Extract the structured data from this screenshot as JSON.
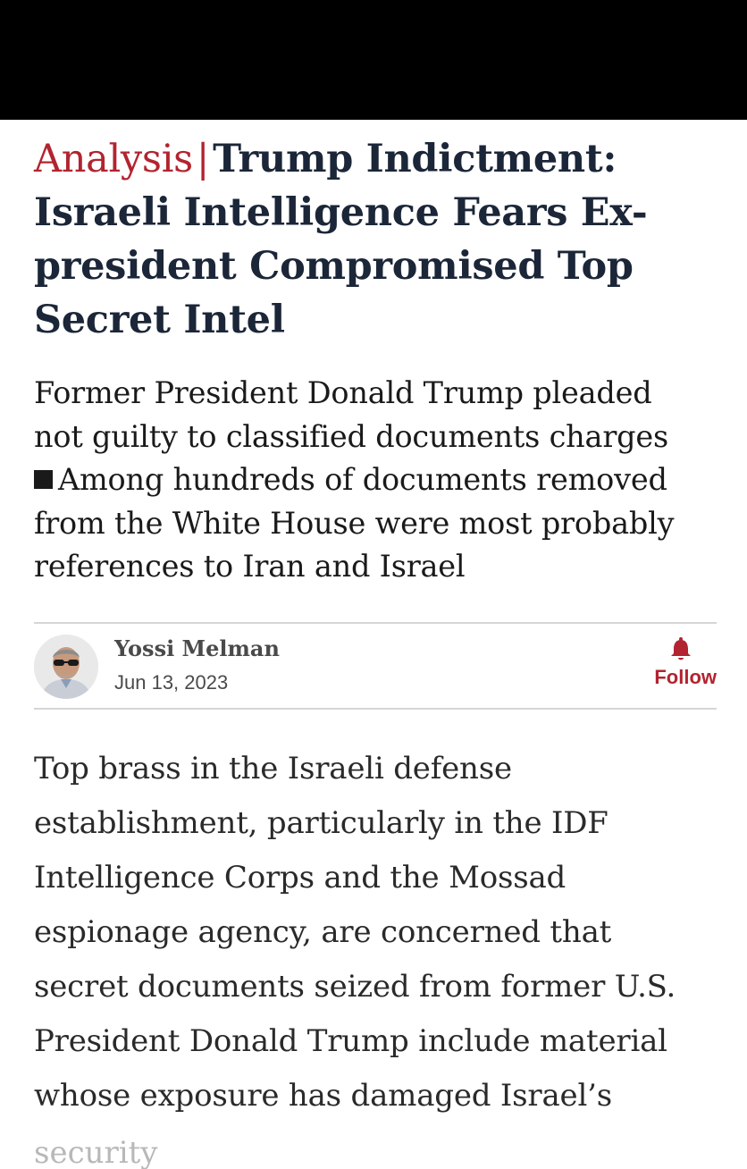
{
  "article": {
    "section_label": "Analysis",
    "separator": "|",
    "headline_line1": "Trump Indictment:",
    "headline_line2": "Israeli Intelligence Fears Ex-",
    "headline_line3": "president Compromised Top",
    "headline_line4": "Secret Intel",
    "subtitle_line1": "Former President Donald Trump pleaded",
    "subtitle_line2": "not guilty to classified documents charges",
    "subtitle_line3": "Among hundreds of documents removed",
    "subtitle_line4": "from the White House were most probably",
    "subtitle_line5": "references to Iran and Israel",
    "author": "Yossi Melman",
    "date": "Jun 13, 2023",
    "follow_label": "Follow",
    "body_lines": [
      "Top brass in the Israeli defense",
      "establishment, particularly in the IDF",
      "Intelligence Corps and the Mossad",
      "espionage agency, are concerned that",
      "secret documents seized from former U.S.",
      "President Donald Trump include material",
      "whose exposure has damaged Israel’s"
    ],
    "body_cutoff": "security"
  },
  "icons": {
    "follow": "bell-icon",
    "bullet": "square-bullet-icon",
    "avatar": "author-avatar"
  },
  "colors": {
    "accent": "#b2242f",
    "headline": "#1b2638",
    "text": "#1a1a1a"
  }
}
